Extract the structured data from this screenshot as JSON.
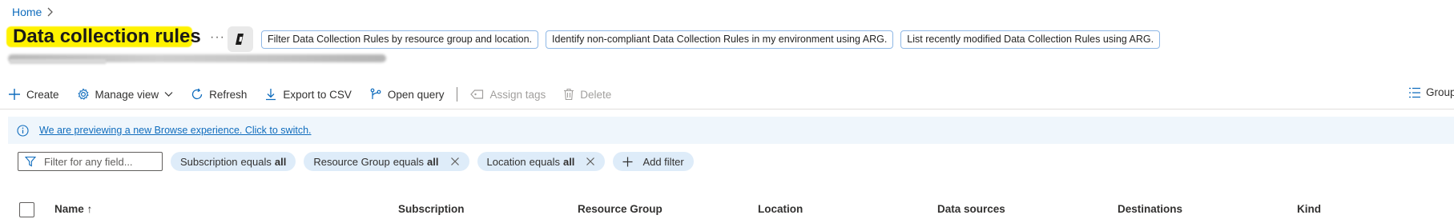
{
  "breadcrumb": {
    "home": "Home"
  },
  "page": {
    "title": "Data collection rules",
    "more": "···"
  },
  "suggestions": [
    "Filter Data Collection Rules by resource group and location.",
    "Identify non-compliant Data Collection Rules in my environment using ARG.",
    "List recently modified Data Collection Rules using ARG."
  ],
  "toolbar": {
    "create": "Create",
    "manage_view": "Manage view",
    "refresh": "Refresh",
    "export_csv": "Export to CSV",
    "open_query": "Open query",
    "assign_tags": "Assign tags",
    "delete": "Delete",
    "group_by": "Group"
  },
  "banner": {
    "text": "We are previewing a new Browse experience. Click to switch."
  },
  "filters": {
    "search_placeholder": "Filter for any field...",
    "pills": [
      {
        "field": "Subscription",
        "op": "equals",
        "value": "all"
      },
      {
        "field": "Resource Group",
        "op": "equals",
        "value": "all"
      },
      {
        "field": "Location",
        "op": "equals",
        "value": "all"
      }
    ],
    "add_filter": "Add filter"
  },
  "table": {
    "columns": [
      "Name ↑",
      "Subscription",
      "Resource Group",
      "Location",
      "Data sources",
      "Destinations",
      "Kind"
    ]
  },
  "colors": {
    "accent": "#0f6cbd",
    "highlight": "#fff200",
    "banner_bg": "#eff6fc",
    "pill_bg": "#deecf9"
  }
}
